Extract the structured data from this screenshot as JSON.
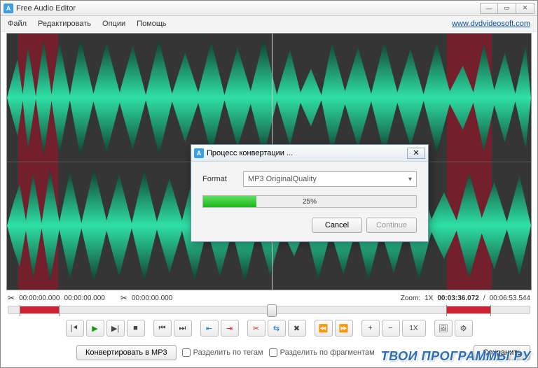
{
  "window": {
    "title": "Free Audio Editor"
  },
  "menu": {
    "file": "Файл",
    "edit": "Редактировать",
    "options": "Опции",
    "help": "Помощь",
    "site": "www.dvdvideosoft.com"
  },
  "times": {
    "sel_start": "00:00:00.000",
    "sel_end": "00:00:00.000",
    "cut_at": "00:00:00.000",
    "zoom_label": "Zoom:",
    "zoom_value": "1X",
    "current": "00:03:36.072",
    "total": "00:06:53.544",
    "sep": "/"
  },
  "toolbar": {
    "speed_label": "1X"
  },
  "footer": {
    "convert": "Конвертировать в MP3",
    "split_tags": "Разделить по тегам",
    "split_fragments": "Разделить по фрагментам",
    "save": "Сохранить"
  },
  "dialog": {
    "title": "Процесс конвертации ...",
    "format_label": "Format",
    "format_value": "MP3 OriginalQuality",
    "progress_pct": "25%",
    "cancel": "Cancel",
    "continue": "Continue"
  },
  "watermark": "ТВОИ ПРОГРАММЫ РУ"
}
